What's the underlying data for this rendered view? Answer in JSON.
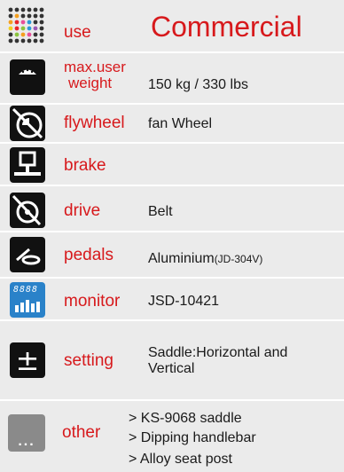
{
  "rows": [
    {
      "label": "use",
      "value": "Commercial"
    },
    {
      "label_line1": "max.user",
      "label_line2": "weight",
      "value": "150 kg / 330 lbs"
    },
    {
      "label": "flywheel",
      "value": "fan Wheel"
    },
    {
      "label": "brake",
      "value": ""
    },
    {
      "label": "drive",
      "value": "Belt"
    },
    {
      "label": "pedals",
      "value_main": "Aluminium",
      "value_note": "(JD-304V)"
    },
    {
      "label": "monitor",
      "value": "JSD-10421",
      "icon_display": "8888"
    },
    {
      "label": "setting",
      "value_line1": "Saddle:Horizontal and",
      "value_line2": "Vertical",
      "icon_symbol": "±"
    },
    {
      "label": "other",
      "bullet_marker": ">",
      "items": [
        "KS-9068 saddle",
        "Dipping handlebar",
        "Alloy seat post"
      ],
      "icon_dots": "..."
    }
  ],
  "colors": {
    "label_red": "#d7191c",
    "background": "#ebebeb",
    "monitor_blue": "#2a82c9"
  },
  "icons": [
    "color-dot-grid-icon",
    "scale-icon",
    "flywheel-icon",
    "brake-icon",
    "drive-icon",
    "pedal-icon",
    "monitor-display-icon",
    "plus-minus-icon",
    "more-dots-icon"
  ]
}
